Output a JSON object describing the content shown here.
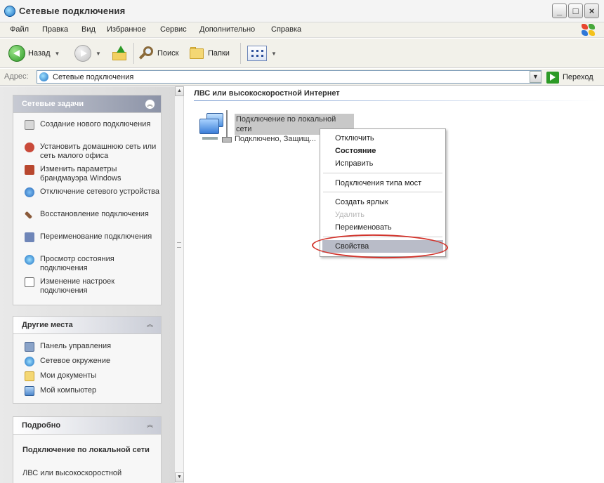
{
  "window": {
    "title": "Сетевые подключения",
    "buttons": {
      "minimize": "_",
      "maximize": "□",
      "close": "×"
    }
  },
  "menubar": {
    "items": [
      "Файл",
      "Правка",
      "Вид",
      "Избранное",
      "Сервис",
      "Дополнительно",
      "Справка"
    ]
  },
  "toolbar": {
    "back": "Назад",
    "search": "Поиск",
    "folders": "Папки"
  },
  "address": {
    "label": "Адрес:",
    "value": "Сетевые подключения",
    "go": "Переход"
  },
  "tasks_panel": {
    "title": "Сетевые задачи",
    "items": [
      {
        "label": "Создание нового подключения",
        "icon": "new-connection-icon"
      },
      {
        "label": "Установить домашнюю сеть или сеть малого офиса",
        "icon": "home-network-icon"
      },
      {
        "label": "Изменить параметры брандмауэра Windows",
        "icon": "firewall-icon"
      },
      {
        "label": "Отключение сетевого устройства",
        "icon": "disable-device-icon"
      },
      {
        "label": "Восстановление подключения",
        "icon": "repair-icon"
      },
      {
        "label": "Переименование подключения",
        "icon": "rename-icon"
      },
      {
        "label": "Просмотр состояния подключения",
        "icon": "status-icon"
      },
      {
        "label": "Изменение настроек подключения",
        "icon": "properties-icon"
      }
    ]
  },
  "places_panel": {
    "title": "Другие места",
    "items": [
      {
        "label": "Панель управления",
        "icon": "control-panel-icon"
      },
      {
        "label": "Сетевое окружение",
        "icon": "network-places-icon"
      },
      {
        "label": "Мои документы",
        "icon": "my-documents-icon"
      },
      {
        "label": "Мой компьютер",
        "icon": "my-computer-icon"
      }
    ]
  },
  "details_panel": {
    "title": "Подробно",
    "name": "Подключение по локальной сети",
    "type": "ЛВС или высокоскоростной"
  },
  "main": {
    "group_header": "ЛВС или высокоскоростной Интернет",
    "connection": {
      "name_line1": "Подключение по локальной",
      "name_line2": "сети",
      "status": "Подключено, Защищ..."
    }
  },
  "context_menu": {
    "items": [
      {
        "label": "Отключить",
        "style": "normal"
      },
      {
        "label": "Состояние",
        "style": "bold"
      },
      {
        "label": "Исправить",
        "style": "normal"
      },
      {
        "label": "Подключения типа мост",
        "style": "normal"
      },
      {
        "label": "Создать ярлык",
        "style": "normal"
      },
      {
        "label": "Удалить",
        "style": "disabled"
      },
      {
        "label": "Переименовать",
        "style": "normal"
      },
      {
        "label": "Свойства",
        "style": "highlighted"
      }
    ]
  }
}
